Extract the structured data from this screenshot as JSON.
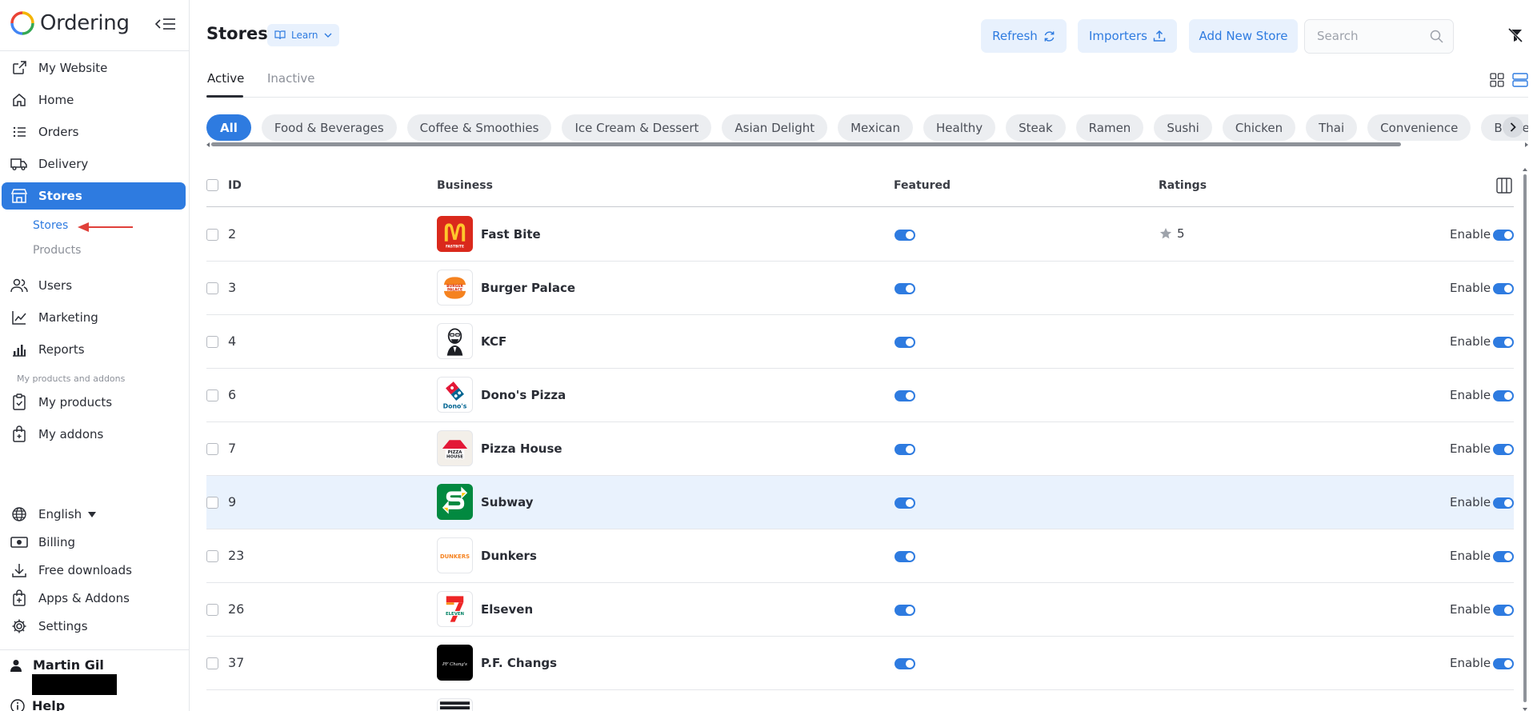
{
  "sidebar": {
    "brand": "Ordering",
    "nav": {
      "my_website": "My Website",
      "home": "Home",
      "orders": "Orders",
      "delivery": "Delivery",
      "stores": "Stores",
      "users": "Users",
      "marketing": "Marketing",
      "reports": "Reports",
      "my_products": "My products",
      "my_addons": "My addons"
    },
    "sub": {
      "stores": "Stores",
      "products": "Products"
    },
    "section_label": "My products and addons",
    "bottom": {
      "language": "English",
      "billing": "Billing",
      "free_downloads": "Free downloads",
      "apps_addons": "Apps & Addons",
      "settings": "Settings"
    },
    "user_name": "Martin Gil",
    "help": "Help"
  },
  "header": {
    "title": "Stores",
    "learn": "Learn",
    "refresh": "Refresh",
    "importers": "Importers",
    "add_new_store": "Add New Store",
    "search_placeholder": "Search"
  },
  "tabs": {
    "active": "Active",
    "inactive": "Inactive"
  },
  "categories": [
    "All",
    "Food & Beverages",
    "Coffee & Smoothies",
    "Ice Cream & Dessert",
    "Asian Delight",
    "Mexican",
    "Healthy",
    "Steak",
    "Ramen",
    "Sushi",
    "Chicken",
    "Thai",
    "Convenience",
    "Burgers"
  ],
  "table": {
    "columns": {
      "id": "ID",
      "business": "Business",
      "featured": "Featured",
      "ratings": "Ratings"
    },
    "enable_label": "Enable",
    "rows": [
      {
        "id": "2",
        "name": "Fast Bite",
        "rating": "5"
      },
      {
        "id": "3",
        "name": "Burger Palace",
        "rating": ""
      },
      {
        "id": "4",
        "name": "KCF",
        "rating": ""
      },
      {
        "id": "6",
        "name": "Dono's Pizza",
        "rating": ""
      },
      {
        "id": "7",
        "name": "Pizza House",
        "rating": ""
      },
      {
        "id": "9",
        "name": "Subway",
        "rating": ""
      },
      {
        "id": "23",
        "name": "Dunkers",
        "rating": ""
      },
      {
        "id": "26",
        "name": "Elseven",
        "rating": ""
      },
      {
        "id": "37",
        "name": "P.F. Changs",
        "rating": ""
      }
    ]
  },
  "logos": {
    "fast_bite": "FASTBITE",
    "burger_palace": "BURGER PALACE",
    "dono": "Dono's",
    "pizza_house": "PIZZA HOUSE",
    "dunkers": "DUNKERS",
    "elseven": "ELEVEN",
    "pf_changs": "PF Chang's"
  },
  "colors": {
    "accent": "#2e7be0",
    "accent_light": "#e8f1fd",
    "highlight_row": "#e9f2fd",
    "arrow_annotation": "#e0403a"
  }
}
